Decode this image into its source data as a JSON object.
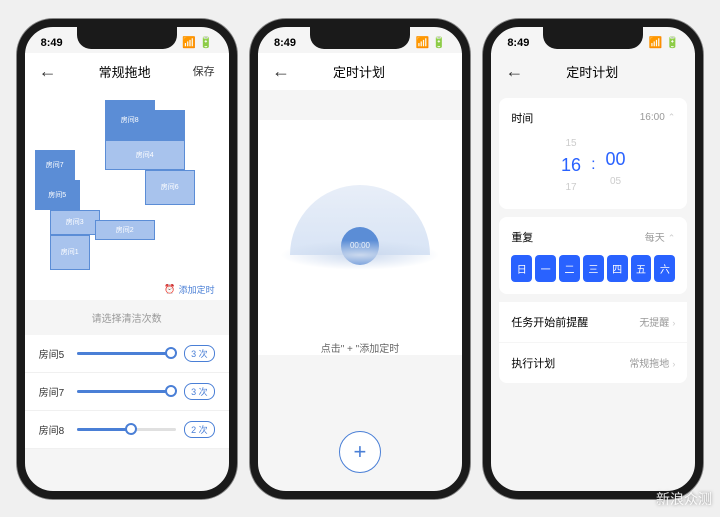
{
  "status": {
    "time": "8:49"
  },
  "screen1": {
    "title": "常规拖地",
    "save": "保存",
    "rooms": [
      "房间1",
      "房间2",
      "房间3",
      "房间4",
      "房间5",
      "房间6",
      "房间7",
      "房间8"
    ],
    "timer_link": "添加定时",
    "section_label": "请选择清洁次数",
    "sliders": [
      {
        "label": "房间5",
        "val": "3 次",
        "pct": 95
      },
      {
        "label": "房间7",
        "val": "3 次",
        "pct": 95
      },
      {
        "label": "房间8",
        "val": "2 次",
        "pct": 55
      }
    ]
  },
  "screen2": {
    "title": "定时计划",
    "clock": "00:00",
    "hint": "点击\" + \"添加定时"
  },
  "screen3": {
    "title": "定时计划",
    "time_label": "时间",
    "time_val": "16:00",
    "picker": {
      "h_prev": "15",
      "h": "16",
      "h_next": "17",
      "m_prev": "",
      "m": "00",
      "m_next": "05"
    },
    "repeat_label": "重复",
    "repeat_val": "每天",
    "days": [
      "日",
      "一",
      "二",
      "三",
      "四",
      "五",
      "六"
    ],
    "remind_label": "任务开始前提醒",
    "remind_val": "无提醒",
    "plan_label": "执行计划",
    "plan_val": "常规拖地"
  },
  "watermark": "新浪众测"
}
